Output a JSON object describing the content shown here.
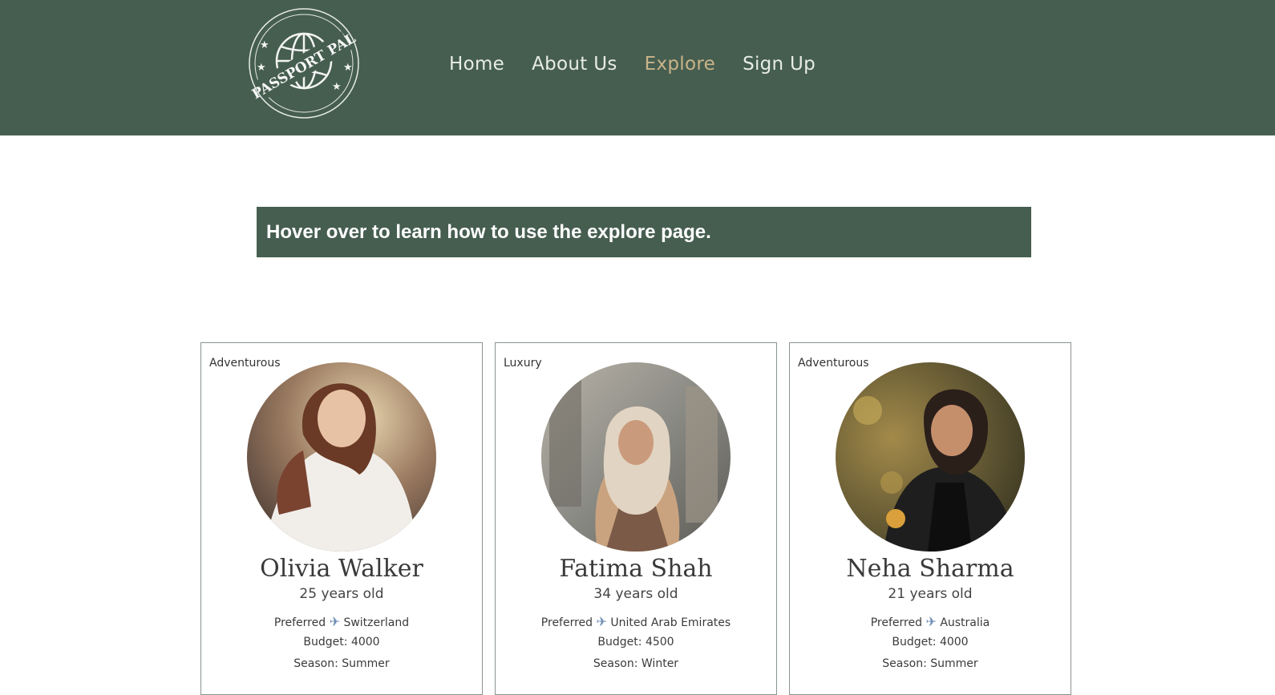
{
  "brand": {
    "logo_text": "PASSPORT PAL"
  },
  "nav": {
    "items": [
      {
        "label": "Home",
        "active": false
      },
      {
        "label": "About Us",
        "active": false
      },
      {
        "label": "Explore",
        "active": true
      },
      {
        "label": "Sign Up",
        "active": false
      }
    ]
  },
  "hint": {
    "text": "Hover over to learn how to use the explore page."
  },
  "cards": [
    {
      "tag": "Adventurous",
      "name": "Olivia Walker",
      "age": "25 years old",
      "preferred_label": "Preferred",
      "preferred_destination": "Switzerland",
      "budget": "Budget: 4000",
      "season": "Season: Summer"
    },
    {
      "tag": "Luxury",
      "name": "Fatima Shah",
      "age": "34 years old",
      "preferred_label": "Preferred",
      "preferred_destination": "United Arab Emirates",
      "budget": "Budget: 4500",
      "season": "Season: Winter"
    },
    {
      "tag": "Adventurous",
      "name": "Neha Sharma",
      "age": "21 years old",
      "preferred_label": "Preferred",
      "preferred_destination": "Australia",
      "budget": "Budget: 4000",
      "season": "Season: Summer"
    }
  ],
  "colors": {
    "header_bg": "#465e50",
    "nav_text": "#e7ece8",
    "nav_active": "#c9b48a",
    "hint_bg": "#465e50"
  },
  "icons": {
    "plane": "airplane-icon"
  }
}
